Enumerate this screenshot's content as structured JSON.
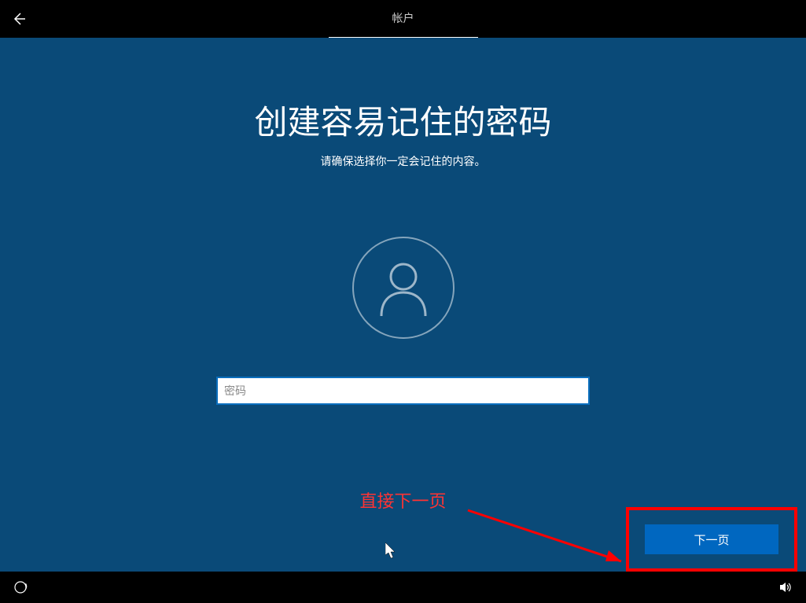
{
  "topbar": {
    "tab_label": "帐户"
  },
  "main": {
    "title": "创建容易记住的密码",
    "subtitle": "请确保选择你一定会记住的内容。",
    "password_placeholder": "密码",
    "next_button": "下一页"
  },
  "annotation": {
    "direct_next": "直接下一页"
  }
}
